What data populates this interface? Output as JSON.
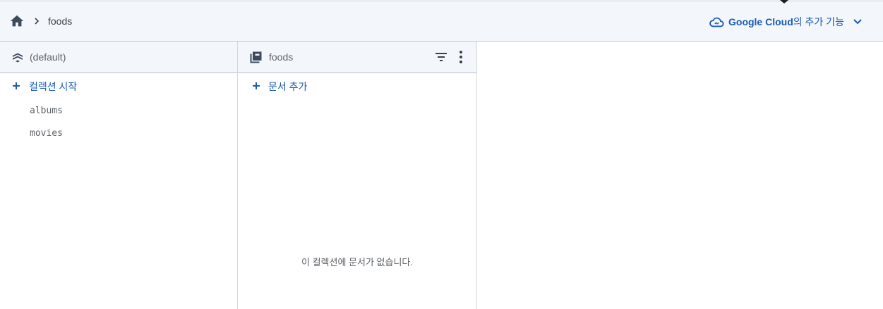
{
  "breadcrumb": {
    "home_icon": "home-icon",
    "separator_icon": "chevron-right-icon",
    "current": "foods"
  },
  "google_cloud": {
    "brand": "Google Cloud",
    "suffix": "의 추가 기능",
    "icon": "cloud-icon",
    "chevron_icon": "chevron-down-icon"
  },
  "database_panel": {
    "title": "(default)",
    "icon": "firestore-icon",
    "add_label": "컬렉션 시작",
    "collections": [
      "albums",
      "movies"
    ]
  },
  "collection_panel": {
    "title": "foods",
    "icon": "collection-icon",
    "filter_icon": "filter-icon",
    "more_icon": "more-vert-icon",
    "add_label": "문서 추가",
    "empty_message": "이 컬렉션에 문서가 없습니다."
  },
  "colors": {
    "accent": "#1a5bb5",
    "header_bg": "#f3f6fb"
  }
}
